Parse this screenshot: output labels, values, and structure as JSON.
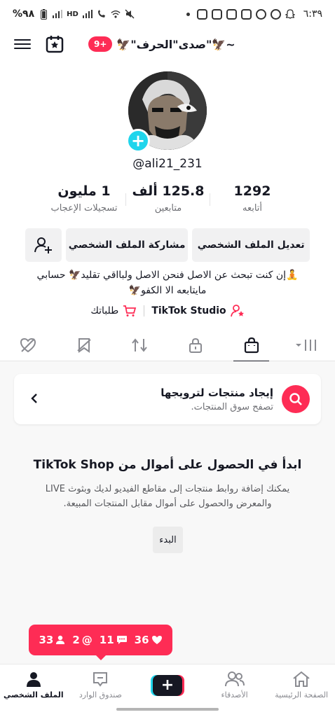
{
  "status_bar": {
    "time": "٦:٣٩",
    "battery": "%٩٨",
    "network": "HD"
  },
  "header": {
    "title": "🦅\"صدى\"الحرف\"🦅~",
    "notification_badge": "9+"
  },
  "profile": {
    "username": "@ali21_231",
    "stats": [
      {
        "value": "1292",
        "label": "أتابعه"
      },
      {
        "value": "125.8 ألف",
        "label": "متابعين"
      },
      {
        "value": "1 مليون",
        "label": "تسجيلات الإعجاب"
      }
    ],
    "buttons": {
      "edit": "تعديل الملف الشخصي",
      "share": "مشاركة الملف الشخصي"
    },
    "bio_line1": "🧘إن كنت تبحث عن الاصل فنحن الاصل ولبااقي تقليد🦅 حسابي",
    "bio_line2": "مايتابعه الا الكفو🦅",
    "studio_link": "TikTok Studio",
    "orders_link": "طلباتك"
  },
  "shop": {
    "promo_title": "إيجاد منتجات لترويجها",
    "promo_subtitle": "تصفح سوق المنتجات.",
    "headline": "ابدأ في الحصول على أموال من TikTok Shop",
    "description": "يمكنك إضافة روابط منتجات إلى مقاطع الفيديو لديك وبثوث LIVE والمعرض والحصول على أموال مقابل المنتجات المبيعة.",
    "start_button": "البدء"
  },
  "notifications": {
    "likes": "36",
    "comments": "11",
    "mentions": "2",
    "followers": "33"
  },
  "bottom_nav": {
    "home": "الصفحة الرئيسية",
    "friends": "الأصدقاء",
    "inbox": "صندوق الوارد",
    "profile": "الملف الشخصي"
  },
  "colors": {
    "accent": "#fe2c55",
    "cyan": "#20d5ec",
    "text": "#161823"
  }
}
